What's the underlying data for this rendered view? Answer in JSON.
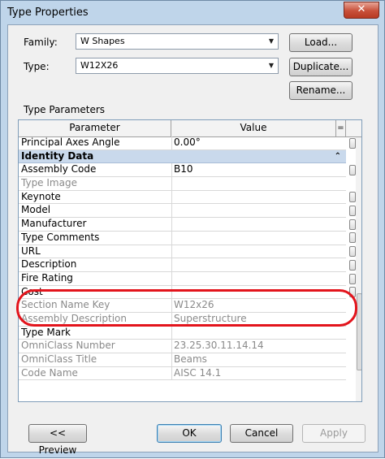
{
  "window": {
    "title": "Type Properties",
    "close_glyph": "✕"
  },
  "form": {
    "family_label": "Family:",
    "family_value": "W Shapes",
    "type_label": "Type:",
    "type_value": "W12X26",
    "load_button": "Load...",
    "duplicate_button": "Duplicate...",
    "rename_button": "Rename..."
  },
  "params": {
    "section_label": "Type Parameters",
    "col_parameter": "Parameter",
    "col_value": "Value",
    "col_toggle": "=",
    "rows": [
      {
        "param": "Principal Axes Angle",
        "value": "0.00°"
      },
      {
        "param": "Identity Data",
        "value": ""
      },
      {
        "param": "Assembly Code",
        "value": "B10"
      },
      {
        "param": "Type Image",
        "value": ""
      },
      {
        "param": "Keynote",
        "value": ""
      },
      {
        "param": "Model",
        "value": ""
      },
      {
        "param": "Manufacturer",
        "value": ""
      },
      {
        "param": "Type Comments",
        "value": ""
      },
      {
        "param": "URL",
        "value": ""
      },
      {
        "param": "Description",
        "value": ""
      },
      {
        "param": "Fire Rating",
        "value": ""
      },
      {
        "param": "Cost",
        "value": ""
      },
      {
        "param": "Section Name Key",
        "value": "W12x26"
      },
      {
        "param": "Assembly Description",
        "value": "Superstructure"
      },
      {
        "param": "Type Mark",
        "value": ""
      },
      {
        "param": "OmniClass Number",
        "value": "23.25.30.11.14.14"
      },
      {
        "param": "OmniClass Title",
        "value": "Beams"
      },
      {
        "param": "Code Name",
        "value": "AISC 14.1"
      }
    ],
    "group_collapse_glyph": "⌃"
  },
  "footer": {
    "preview_button": "<< Preview",
    "ok_button": "OK",
    "cancel_button": "Cancel",
    "apply_button": "Apply"
  },
  "colors": {
    "annotation": "#e3141c",
    "group_band": "#c9d9ec"
  }
}
